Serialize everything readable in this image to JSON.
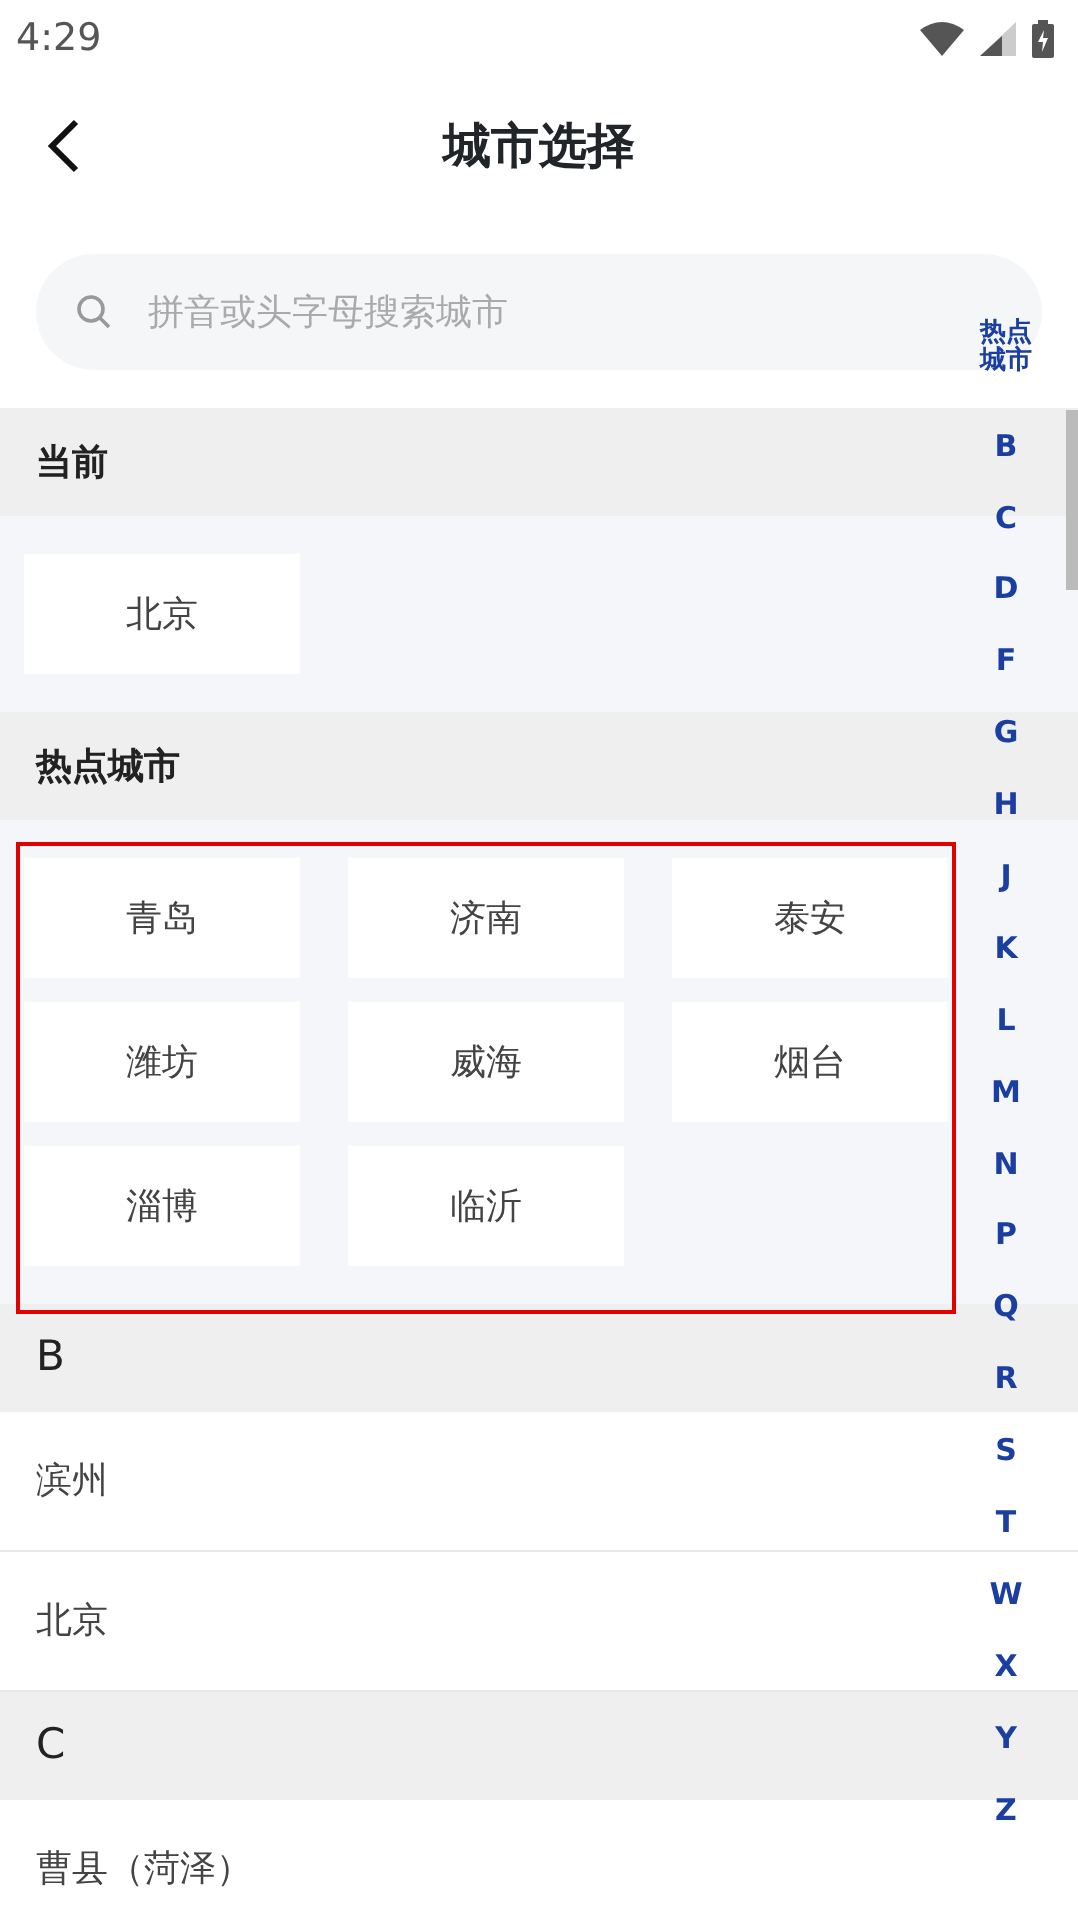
{
  "status_bar": {
    "time": "4:29"
  },
  "header": {
    "title": "城市选择"
  },
  "search": {
    "placeholder": "拼音或头字母搜索城市"
  },
  "sections": [
    {
      "kind": "chips",
      "heading": "当前",
      "highlighted": false,
      "cities": [
        "北京"
      ]
    },
    {
      "kind": "chips",
      "heading": "热点城市",
      "highlighted": true,
      "cities": [
        "青岛",
        "济南",
        "泰安",
        "潍坊",
        "威海",
        "烟台",
        "淄博",
        "临沂"
      ]
    },
    {
      "kind": "list",
      "heading": "B",
      "cities": [
        "滨州",
        "北京"
      ]
    },
    {
      "kind": "list",
      "heading": "C",
      "cities": [
        "曹县（菏泽）"
      ]
    }
  ],
  "index": [
    "热点城市",
    "B",
    "C",
    "D",
    "F",
    "G",
    "H",
    "J",
    "K",
    "L",
    "M",
    "N",
    "P",
    "Q",
    "R",
    "S",
    "T",
    "W",
    "X",
    "Y",
    "Z"
  ]
}
